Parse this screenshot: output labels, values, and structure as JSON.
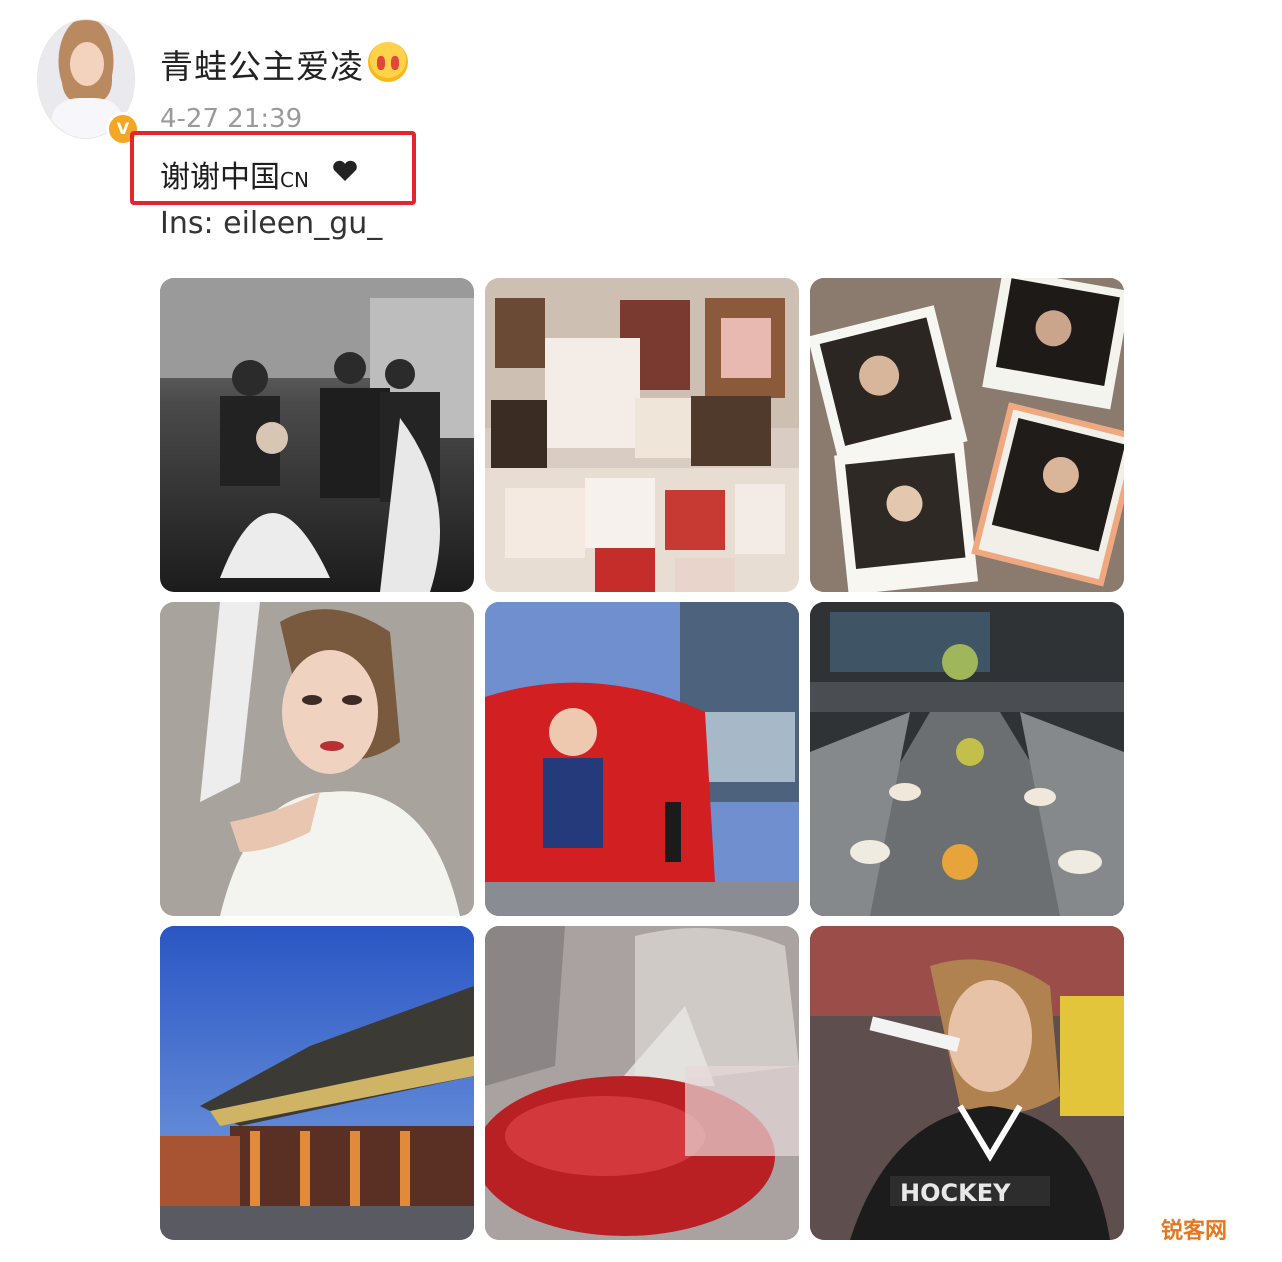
{
  "post": {
    "username": "青蛙公主爱凌",
    "timestamp": "4-27 21:39",
    "verified_badge": "V",
    "text_main": "谢谢中国",
    "text_cn": "CN",
    "text_ins": "Ins: eileen_gu_"
  },
  "photos": [
    {
      "name": "photo-bw-makeup",
      "kind": "bw"
    },
    {
      "name": "photo-framed-artworks",
      "kind": "frames"
    },
    {
      "name": "photo-polaroids",
      "kind": "polaroids"
    },
    {
      "name": "photo-portrait-white-robe",
      "kind": "portrait"
    },
    {
      "name": "photo-red-screen-plaza",
      "kind": "screen"
    },
    {
      "name": "photo-banquet-table",
      "kind": "banquet"
    },
    {
      "name": "photo-palace-night",
      "kind": "palace"
    },
    {
      "name": "photo-red-roses-stage",
      "kind": "roses"
    },
    {
      "name": "photo-jersey-selfie",
      "kind": "jersey"
    }
  ],
  "watermark": "锐客网",
  "colors": {
    "highlight": "#e2262c",
    "verified": "#f5a623",
    "watermark": "#e7771f"
  }
}
